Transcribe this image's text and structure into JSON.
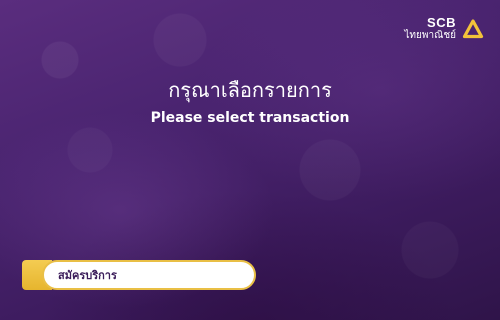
{
  "brand": {
    "name": "SCB",
    "name_th": "ไทยพาณิชย์",
    "logo_color": "#f2c23a"
  },
  "heading": {
    "title_th": "กรุณาเลือกรายการ",
    "title_en": "Please select transaction"
  },
  "transactions": [
    {
      "label": "สมัครบริการ"
    }
  ],
  "colors": {
    "background": "#4a2470",
    "accent": "#e9bf45",
    "text": "#ffffff"
  }
}
